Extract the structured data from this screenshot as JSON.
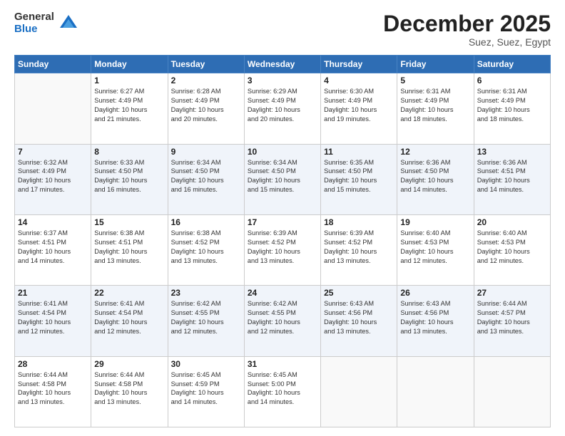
{
  "header": {
    "logo_general": "General",
    "logo_blue": "Blue",
    "month_title": "December 2025",
    "location": "Suez, Suez, Egypt"
  },
  "days_of_week": [
    "Sunday",
    "Monday",
    "Tuesday",
    "Wednesday",
    "Thursday",
    "Friday",
    "Saturday"
  ],
  "weeks": [
    [
      {
        "day": "",
        "info": ""
      },
      {
        "day": "1",
        "info": "Sunrise: 6:27 AM\nSunset: 4:49 PM\nDaylight: 10 hours\nand 21 minutes."
      },
      {
        "day": "2",
        "info": "Sunrise: 6:28 AM\nSunset: 4:49 PM\nDaylight: 10 hours\nand 20 minutes."
      },
      {
        "day": "3",
        "info": "Sunrise: 6:29 AM\nSunset: 4:49 PM\nDaylight: 10 hours\nand 20 minutes."
      },
      {
        "day": "4",
        "info": "Sunrise: 6:30 AM\nSunset: 4:49 PM\nDaylight: 10 hours\nand 19 minutes."
      },
      {
        "day": "5",
        "info": "Sunrise: 6:31 AM\nSunset: 4:49 PM\nDaylight: 10 hours\nand 18 minutes."
      },
      {
        "day": "6",
        "info": "Sunrise: 6:31 AM\nSunset: 4:49 PM\nDaylight: 10 hours\nand 18 minutes."
      }
    ],
    [
      {
        "day": "7",
        "info": "Sunrise: 6:32 AM\nSunset: 4:49 PM\nDaylight: 10 hours\nand 17 minutes."
      },
      {
        "day": "8",
        "info": "Sunrise: 6:33 AM\nSunset: 4:50 PM\nDaylight: 10 hours\nand 16 minutes."
      },
      {
        "day": "9",
        "info": "Sunrise: 6:34 AM\nSunset: 4:50 PM\nDaylight: 10 hours\nand 16 minutes."
      },
      {
        "day": "10",
        "info": "Sunrise: 6:34 AM\nSunset: 4:50 PM\nDaylight: 10 hours\nand 15 minutes."
      },
      {
        "day": "11",
        "info": "Sunrise: 6:35 AM\nSunset: 4:50 PM\nDaylight: 10 hours\nand 15 minutes."
      },
      {
        "day": "12",
        "info": "Sunrise: 6:36 AM\nSunset: 4:50 PM\nDaylight: 10 hours\nand 14 minutes."
      },
      {
        "day": "13",
        "info": "Sunrise: 6:36 AM\nSunset: 4:51 PM\nDaylight: 10 hours\nand 14 minutes."
      }
    ],
    [
      {
        "day": "14",
        "info": "Sunrise: 6:37 AM\nSunset: 4:51 PM\nDaylight: 10 hours\nand 14 minutes."
      },
      {
        "day": "15",
        "info": "Sunrise: 6:38 AM\nSunset: 4:51 PM\nDaylight: 10 hours\nand 13 minutes."
      },
      {
        "day": "16",
        "info": "Sunrise: 6:38 AM\nSunset: 4:52 PM\nDaylight: 10 hours\nand 13 minutes."
      },
      {
        "day": "17",
        "info": "Sunrise: 6:39 AM\nSunset: 4:52 PM\nDaylight: 10 hours\nand 13 minutes."
      },
      {
        "day": "18",
        "info": "Sunrise: 6:39 AM\nSunset: 4:52 PM\nDaylight: 10 hours\nand 13 minutes."
      },
      {
        "day": "19",
        "info": "Sunrise: 6:40 AM\nSunset: 4:53 PM\nDaylight: 10 hours\nand 12 minutes."
      },
      {
        "day": "20",
        "info": "Sunrise: 6:40 AM\nSunset: 4:53 PM\nDaylight: 10 hours\nand 12 minutes."
      }
    ],
    [
      {
        "day": "21",
        "info": "Sunrise: 6:41 AM\nSunset: 4:54 PM\nDaylight: 10 hours\nand 12 minutes."
      },
      {
        "day": "22",
        "info": "Sunrise: 6:41 AM\nSunset: 4:54 PM\nDaylight: 10 hours\nand 12 minutes."
      },
      {
        "day": "23",
        "info": "Sunrise: 6:42 AM\nSunset: 4:55 PM\nDaylight: 10 hours\nand 12 minutes."
      },
      {
        "day": "24",
        "info": "Sunrise: 6:42 AM\nSunset: 4:55 PM\nDaylight: 10 hours\nand 12 minutes."
      },
      {
        "day": "25",
        "info": "Sunrise: 6:43 AM\nSunset: 4:56 PM\nDaylight: 10 hours\nand 13 minutes."
      },
      {
        "day": "26",
        "info": "Sunrise: 6:43 AM\nSunset: 4:56 PM\nDaylight: 10 hours\nand 13 minutes."
      },
      {
        "day": "27",
        "info": "Sunrise: 6:44 AM\nSunset: 4:57 PM\nDaylight: 10 hours\nand 13 minutes."
      }
    ],
    [
      {
        "day": "28",
        "info": "Sunrise: 6:44 AM\nSunset: 4:58 PM\nDaylight: 10 hours\nand 13 minutes."
      },
      {
        "day": "29",
        "info": "Sunrise: 6:44 AM\nSunset: 4:58 PM\nDaylight: 10 hours\nand 13 minutes."
      },
      {
        "day": "30",
        "info": "Sunrise: 6:45 AM\nSunset: 4:59 PM\nDaylight: 10 hours\nand 14 minutes."
      },
      {
        "day": "31",
        "info": "Sunrise: 6:45 AM\nSunset: 5:00 PM\nDaylight: 10 hours\nand 14 minutes."
      },
      {
        "day": "",
        "info": ""
      },
      {
        "day": "",
        "info": ""
      },
      {
        "day": "",
        "info": ""
      }
    ]
  ]
}
